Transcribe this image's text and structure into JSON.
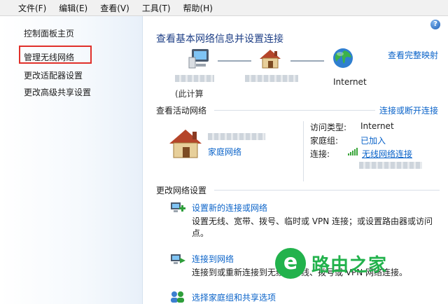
{
  "menubar": {
    "items": [
      "文件(F)",
      "编辑(E)",
      "查看(V)",
      "工具(T)",
      "帮助(H)"
    ]
  },
  "sidebar": {
    "links": [
      "控制面板主页",
      "管理无线网络",
      "更改适配器设置",
      "更改高级共享设置"
    ]
  },
  "main": {
    "help": "?",
    "title": "查看基本网络信息并设置连接",
    "view_full_map": "查看完整映射",
    "map": {
      "computer_name": "(此计算",
      "internet_label": "Internet"
    },
    "active": {
      "section_title": "查看活动网络",
      "connect_disconnect": "连接或断开连接",
      "network_type": "家庭网络",
      "access_type_label": "访问类型:",
      "access_type_value": "Internet",
      "homegroup_label": "家庭组:",
      "homegroup_value": "已加入",
      "connection_label": "连接:",
      "connection_value": "无线网络连接"
    },
    "change": {
      "section_title": "更改网络设置",
      "tasks": [
        {
          "link": "设置新的连接或网络",
          "desc": "设置无线、宽带、拨号、临时或 VPN 连接；或设置路由器或访问点。"
        },
        {
          "link": "连接到网络",
          "desc": "连接到或重新连接到无线、有线、拨号或 VPN 网络连接。"
        },
        {
          "link": "选择家庭组和共享选项"
        }
      ]
    }
  },
  "watermark": {
    "mark": "e",
    "text": "路由之家"
  },
  "colors": {
    "link": "#0a63c9",
    "title": "#1e3f86",
    "highlight_box": "#e0302a",
    "watermark": "#22b24c"
  }
}
